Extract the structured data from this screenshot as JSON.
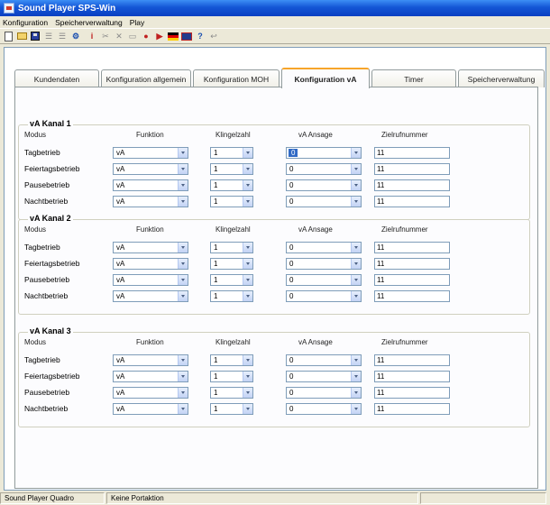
{
  "window": {
    "title": "Sound Player SPS-Win"
  },
  "menu": [
    "Konfiguration",
    "Speicherverwaltung",
    "Play"
  ],
  "toolbar_icons": [
    "new-document",
    "open-folder",
    "save-disk",
    "list-view",
    "list-view",
    "tool",
    "info",
    "cut",
    "delete",
    "copy",
    "record",
    "play",
    "flag-de",
    "flag-uk",
    "help-pointer",
    "undo"
  ],
  "tabs": [
    "Kundendaten",
    "Konfiguration allgemein",
    "Konfiguration MOH",
    "Konfiguration vA",
    "Timer",
    "Speicherverwaltung"
  ],
  "active_tab": "Konfiguration vA",
  "columns": {
    "modus": "Modus",
    "funktion": "Funktion",
    "klingelzahl": "Klingelzahl",
    "ansage": "vA Ansage",
    "ziel": "Zielrufnummer"
  },
  "kanaele": [
    {
      "title": "vA Kanal 1",
      "rows": [
        {
          "label": "Tagbetrieb",
          "funktion": "vA",
          "klingel": "1",
          "ansage": "0",
          "ziel": "11"
        },
        {
          "label": "Feiertagsbetrieb",
          "funktion": "vA",
          "klingel": "1",
          "ansage": "0",
          "ziel": "11"
        },
        {
          "label": "Pausebetrieb",
          "funktion": "vA",
          "klingel": "1",
          "ansage": "0",
          "ziel": "11"
        },
        {
          "label": "Nachtbetrieb",
          "funktion": "vA",
          "klingel": "1",
          "ansage": "0",
          "ziel": "11"
        }
      ]
    },
    {
      "title": "vA Kanal 2",
      "rows": [
        {
          "label": "Tagbetrieb",
          "funktion": "vA",
          "klingel": "1",
          "ansage": "0",
          "ziel": "11"
        },
        {
          "label": "Feiertagsbetrieb",
          "funktion": "vA",
          "klingel": "1",
          "ansage": "0",
          "ziel": "11"
        },
        {
          "label": "Pausebetrieb",
          "funktion": "vA",
          "klingel": "1",
          "ansage": "0",
          "ziel": "11"
        },
        {
          "label": "Nachtbetrieb",
          "funktion": "vA",
          "klingel": "1",
          "ansage": "0",
          "ziel": "11"
        }
      ]
    },
    {
      "title": "vA Kanal 3",
      "rows": [
        {
          "label": "Tagbetrieb",
          "funktion": "vA",
          "klingel": "1",
          "ansage": "0",
          "ziel": "11"
        },
        {
          "label": "Feiertagsbetrieb",
          "funktion": "vA",
          "klingel": "1",
          "ansage": "0",
          "ziel": "11"
        },
        {
          "label": "Pausebetrieb",
          "funktion": "vA",
          "klingel": "1",
          "ansage": "0",
          "ziel": "11"
        },
        {
          "label": "Nachtbetrieb",
          "funktion": "vA",
          "klingel": "1",
          "ansage": "0",
          "ziel": "11"
        }
      ]
    }
  ],
  "status": {
    "device": "Sound Player Quadro",
    "message": "Keine Portaktion"
  },
  "colors": {
    "titlebar": "#0a3fc2",
    "tab_highlight": "#f7a52a",
    "selection": "#316ac5"
  }
}
